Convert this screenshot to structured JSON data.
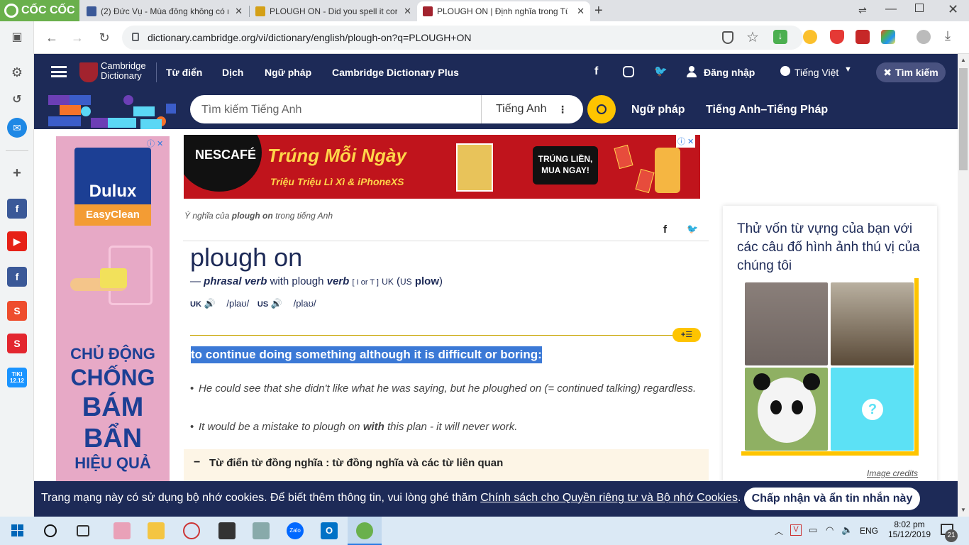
{
  "browser": {
    "brand": "CỐC CỐC",
    "tabs": [
      {
        "title": "(2) Đức Vụ - Mùa đông không có n",
        "active": false
      },
      {
        "title": "PLOUGH ON - Did you spell it corr",
        "active": false
      },
      {
        "title": "PLOUGH ON | Định nghĩa trong Từ",
        "active": true
      }
    ],
    "url": "dictionary.cambridge.org/vi/dictionary/english/plough-on?q=PLOUGH+ON"
  },
  "header": {
    "logo_line1": "Cambridge",
    "logo_line2": "Dictionary",
    "nav": [
      "Từ điển",
      "Dịch",
      "Ngữ pháp",
      "Cambridge Dictionary Plus"
    ],
    "login": "Đăng nhập",
    "language": "Tiếng Việt",
    "search_pill": "Tìm kiếm"
  },
  "subheader": {
    "search_placeholder": "Tìm kiếm Tiếng Anh",
    "search_lang": "Tiếng Anh",
    "links": [
      "Ngữ pháp",
      "Tiếng Anh–Tiếng Pháp"
    ]
  },
  "ads": {
    "left_brand": "Dulux",
    "left_sub": "EasyClean",
    "left_lines": [
      "CHỦ ĐỘNG",
      "CHỐNG",
      "BÁM",
      "BẨN",
      "HIỆU QUẢ"
    ],
    "top_brand": "NESCAFÉ",
    "top_headline": "Trúng Mỗi Ngày",
    "top_sub": "Triệu Triệu Lì Xì & iPhoneXS",
    "top_cta": "TRÚNG LIỀN, MUA NGAY!"
  },
  "entry": {
    "meaning_prefix": "Ý nghĩa của",
    "meaning_word": "plough on",
    "meaning_suffix": "trong tiếng Anh",
    "headword": "plough on",
    "pos_dash": "—",
    "pos": "phrasal verb",
    "pos_with": "with plough",
    "pos_verb": "verb",
    "grammar": "[ I or T ]",
    "region_uk": "UK",
    "region_us": "US",
    "variant": "plow",
    "pron_uk_label": "UK",
    "pron_uk": "/plaʊ/",
    "pron_us_label": "US",
    "pron_us": "/plaʊ/",
    "definition": "to continue doing something although it is difficult or boring:",
    "examples": [
      {
        "pre": "He could see that she didn't like what he was saying, but he ploughed on (= continued talking) regardless.",
        "bold": "",
        "post": ""
      },
      {
        "pre": "It would be a mistake to plough on ",
        "bold": "with",
        "post": " this plan - it will never work."
      }
    ],
    "thesaurus": "Từ điển từ đồng nghĩa : từ đồng nghĩa và các từ liên quan"
  },
  "quiz": {
    "text": "Thử vốn từ vựng của bạn với các câu đố hình ảnh thú vị của chúng tôi",
    "credits": "Image credits",
    "question_mark": "?"
  },
  "cookie": {
    "text": "Trang mạng này có sử dụng bộ nhớ cookies. Để biết thêm thông tin, vui lòng ghé thăm",
    "link": "Chính sách cho Quyền riêng tư và Bộ nhớ Cookies",
    "period": ".",
    "button": "Chấp nhận và ẩn tin nhắn này"
  },
  "taskbar": {
    "lang": "ENG",
    "time": "8:02 pm",
    "date": "15/12/2019",
    "notif_count": "21",
    "tiki": "TIKI 12.12"
  },
  "colors": {
    "cd_blue": "#1d2a57",
    "accent_yellow": "#fec400",
    "highlight": "#3b79d6"
  }
}
